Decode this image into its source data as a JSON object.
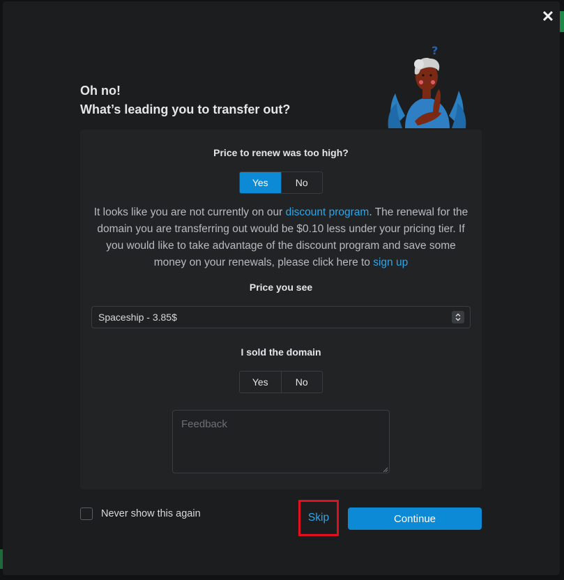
{
  "dialog": {
    "close_label": "✕",
    "heading_line1": "Oh no!",
    "heading_line2": "What’s leading you to transfer out?"
  },
  "question1": {
    "title": "Price to renew was too high?",
    "options": [
      "Yes",
      "No"
    ],
    "selected": "Yes"
  },
  "info": {
    "text_before_link": "It looks like you are not currently on our ",
    "link1": "discount program",
    "text_middle": ". The renewal for the domain you are transferring out would be $0.10 less under your pricing tier. If you would like to take advantage of the discount program and save some money on your renewals, please click here to ",
    "link2": "sign up"
  },
  "price_select": {
    "label": "Price you see",
    "value": "Spaceship - 3.85$"
  },
  "question2": {
    "title": "I sold the domain",
    "options": [
      "Yes",
      "No"
    ],
    "selected": null
  },
  "feedback": {
    "placeholder": "Feedback"
  },
  "footer": {
    "never_show_label": "Never show this again",
    "skip_label": "Skip",
    "continue_label": "Continue"
  },
  "colors": {
    "accent": "#0d8ad6",
    "link": "#2ea6ea",
    "highlight_box": "#e01020",
    "panel_bg": "#212325",
    "modal_bg": "#1b1d1f"
  },
  "icons": [
    "close-icon",
    "spinner-arrows-icon",
    "thinking-person-illustration",
    "resize-grip-icon"
  ]
}
